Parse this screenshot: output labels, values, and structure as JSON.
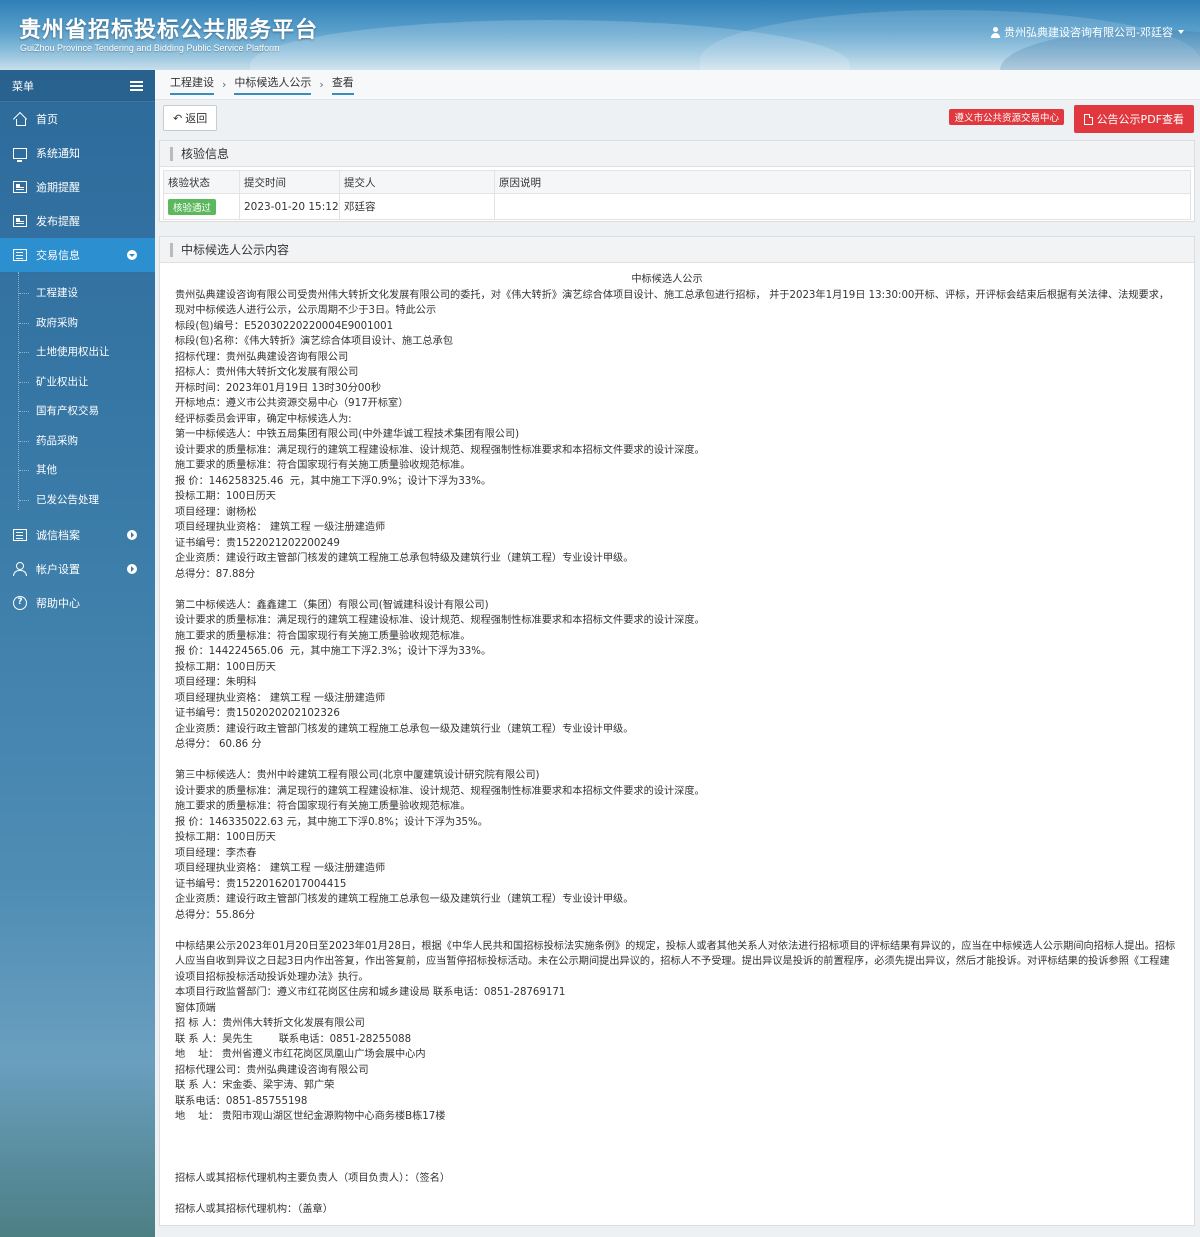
{
  "header": {
    "title": "贵州省招标投标公共服务平台",
    "subtitle": "GuiZhou Province Tendering and Bidding Public Service Platform",
    "user": "贵州弘典建设咨询有限公司-邓廷容"
  },
  "sidebar": {
    "menu_label": "菜单",
    "items": [
      {
        "label": "首页",
        "icon": "home-icon"
      },
      {
        "label": "系统通知",
        "icon": "monitor-icon"
      },
      {
        "label": "逾期提醒",
        "icon": "doc-icon"
      },
      {
        "label": "发布提醒",
        "icon": "doc-icon"
      },
      {
        "label": "交易信息",
        "icon": "list-icon",
        "active": true,
        "expanded": true
      },
      {
        "label": "诚信档案",
        "icon": "list-icon"
      },
      {
        "label": "帐户设置",
        "icon": "user-icon"
      },
      {
        "label": "帮助中心",
        "icon": "help-icon"
      }
    ],
    "sub_items": [
      "工程建设",
      "政府采购",
      "土地使用权出让",
      "矿业权出让",
      "国有产权交易",
      "药品采购",
      "其他",
      "已发公告处理"
    ]
  },
  "breadcrumb": [
    "工程建设",
    "中标候选人公示",
    "查看"
  ],
  "toolbar": {
    "back_label": "返回",
    "source_tag": "遵义市公共资源交易中心",
    "pdf_label": "公告公示PDF查看"
  },
  "colors": {
    "accent": "#2b8fd0",
    "danger": "#e0383e",
    "success": "#5cb85c"
  },
  "verify": {
    "heading": "核验信息",
    "columns": [
      "核验状态",
      "提交时间",
      "提交人",
      "原因说明"
    ],
    "row": {
      "status": "核验通过",
      "time": "2023-01-20 15:12",
      "submitter": "邓廷容",
      "reason": ""
    }
  },
  "content": {
    "heading": "中标候选人公示内容",
    "doc_title": "中标候选人公示",
    "intro": "贵州弘典建设咨询有限公司受贵州伟大转折文化发展有限公司的委托，对《伟大转折》演艺综合体项目设计、施工总承包进行招标， 并于2023年1月19日 13:30:00开标、评标，开评标会结束后根据有关法律、法规要求，现对中标候选人进行公示，公示周期不少于3日。特此公示",
    "block1": [
      "标段(包)编号：E5203022022000​4E9001001",
      "标段(包)名称：《伟大转折》演艺综合体项目设计、施工总承包",
      "招标代理：贵州弘典建设咨询有限公司",
      "招标人：贵州伟大转折文化发展有限公司",
      "开标时间：2023年01月19日 13时30分00秒",
      "开标地点：遵义市公共资源交易中心（917开标室）",
      "经评标委员会评审，确定中标候选人为:",
      "第一中标候选人：中铁五局集团有限公司(中外建华诚工程技术集团有限公司)",
      "设计要求的质量标准：满足现行的建筑工程建设标准、设计规范、规程强制性标准要求和本招标文件要求的设计深度。",
      "施工要求的质量标准：符合国家现行有关施工质量验收规范标准。",
      "报 价：146258325.46  元，其中施工下浮0.9%；设计下浮为33%。",
      "投标工期：100日历天",
      "项目经理：谢杨松",
      "项目经理执业资格： 建筑工程 一级注册建造师",
      "证书编号：贵1522021202200249",
      "企业资质：建设行政主管部门核发的建筑工程施工总承包特级及建筑行业（建筑工程）专业设计甲级。",
      "总得分：87.88分"
    ],
    "block2": [
      "第二中标候选人：鑫鑫建工（集团）有限公司(智诚建科设计有限公司)",
      "设计要求的质量标准：满足现行的建筑工程建设标准、设计规范、规程强制性标准要求和本招标文件要求的设计深度。",
      "施工要求的质量标准：符合国家现行有关施工质量验收规范标准。",
      "报 价：144224565.06  元，其中施工下浮2.3%；设计下浮为33%。",
      "投标工期：100日历天",
      "项目经理：朱明科",
      "项目经理执业资格： 建筑工程 一级注册建造师",
      "证书编号：贵1502020202102326",
      "企业资质：建设行政主管部门核发的建筑工程施工总承包一级及建筑行业（建筑工程）专业设计甲级。",
      "总得分： 60.86 分"
    ],
    "block3": [
      "第三中标候选人：贵州中岭建筑工程有限公司(北京中厦建筑设计研究院有限公司)",
      "设计要求的质量标准：满足现行的建筑工程建设标准、设计规范、规程强制性标准要求和本招标文件要求的设计深度。",
      "施工要求的质量标准：符合国家现行有关施工质量验收规范标准。",
      "报 价：146335022.63 元，其中施工下浮0.8%；设计下浮为35%。",
      "投标工期：100日历天",
      "项目经理：李杰春",
      "项目经理执业资格： 建筑工程 一级注册建造师",
      "证书编号：贵15220162017004415",
      "企业资质：建设行政主管部门核发的建筑工程施工总承包一级及建筑行业（建筑工程）专业设计甲级。",
      "总得分：55.86分"
    ],
    "notice": "中标结果公示2023年01月20日至2023年01月28日，根据《中华人民共和国招标投标法实施条例》的规定，投标人或者其他关系人对依法进行招标项目的评标结果有异议的，应当在中标候选人公示期间向招标人提出。招标人应当自收到异议之日起3日内作出答复，作出答复前，应当暂停招标投标活动。未在公示期间提出异议的，招标人不予受理。提出异议是投诉的前置程序，必须先提出异议，然后才能投诉。对评标结果的投诉参照《工程建设项目招标投标活动投诉处理办法》执行。",
    "block4": [
      "本项目行政监督部门：遵义市红花岗区住房和城乡建设局 联系电话：0851-28769171",
      "窗体顶端",
      "招 标 人：贵州伟大转折文化发展有限公司",
      "联 系 人：吴先生        联系电话：0851-28255088",
      "地    址： 贵州省遵义市红花岗区凤凰山广场会展中心内",
      "招标代理公司：贵州弘典建设咨询有限公司",
      "联 系 人：宋金委、梁宇涛、郭广荣",
      "联系电话：0851-85755198",
      "地    址： 贵阳市观山湖区世纪金源购物中心商务楼B栋17楼"
    ],
    "sign1": "招标人或其招标代理机构主要负责人（项目负责人）：（签名）",
    "sign2": "招标人或其招标代理机构：（盖章）"
  }
}
